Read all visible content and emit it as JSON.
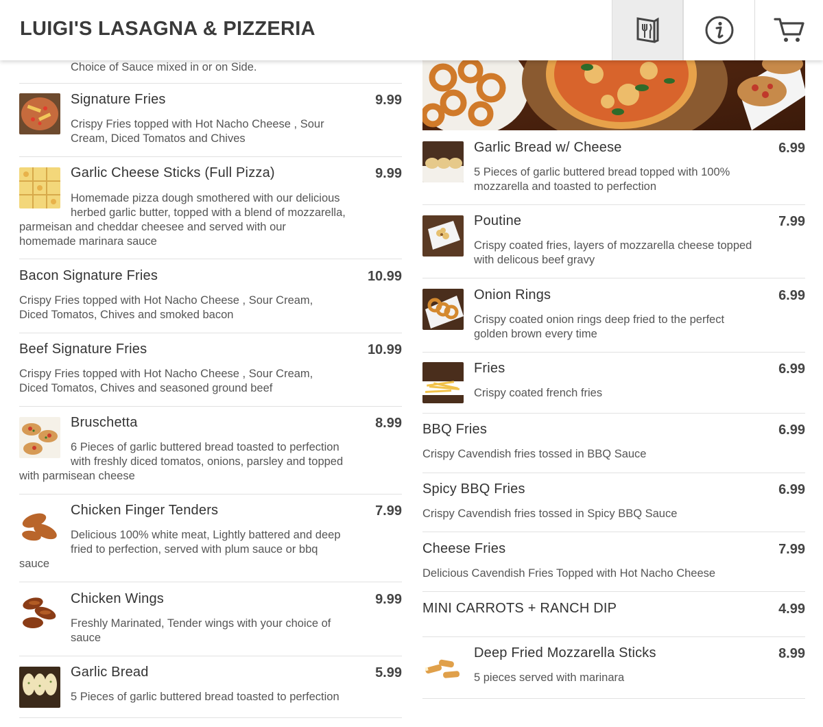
{
  "header": {
    "title": "LUIGI'S LASAGNA & PIZZERIA",
    "icons": {
      "menu": "menu-utensils-icon",
      "info": "info-icon",
      "cart": "cart-icon"
    }
  },
  "colors": {
    "accent_bg": "#ececec",
    "text": "#333333",
    "price": "#444444"
  },
  "left": {
    "partial_desc": "Choice of Sauce mixed in or on Side.",
    "items": [
      {
        "name": "Signature Fries",
        "price": "9.99",
        "desc1": "Crispy Fries topped with Hot Nacho Cheese , Sour",
        "desc2": "Cream, Diced Tomatos and Chives",
        "icon": "signature-fries-photo"
      },
      {
        "name": "Garlic Cheese Sticks (Full Pizza)",
        "price": "9.99",
        "desc1": "Homemade pizza dough smothered with our delicious",
        "desc2": "herbed garlic butter, topped with a blend of mozzarella,",
        "desc3": "parmeisan and cheddar cheesee and served with our",
        "desc4": "homemade marinara sauce",
        "icon": "garlic-cheese-sticks-photo"
      },
      {
        "name": "Bacon Signature Fries",
        "price": "10.99",
        "desc1": "Crispy Fries topped with Hot Nacho Cheese , Sour Cream,",
        "desc2": "Diced Tomatos, Chives and smoked bacon"
      },
      {
        "name": "Beef Signature Fries",
        "price": "10.99",
        "desc1": "Crispy Fries topped with Hot Nacho Cheese , Sour Cream,",
        "desc2": "Diced Tomatos, Chives and seasoned ground beef"
      },
      {
        "name": "Bruschetta",
        "price": "8.99",
        "desc1": "6 Pieces of garlic buttered bread toasted to perfection",
        "desc2": "with freshly diced tomatos, onions, parsley and topped",
        "desc3": "with parmisean cheese",
        "icon": "bruschetta-photo"
      },
      {
        "name": "Chicken Finger Tenders",
        "price": "7.99",
        "desc1": "Delicious 100% white meat, Lightly battered and deep",
        "desc2": "fried to perfection, served with plum sauce or bbq",
        "desc3": "sauce",
        "icon": "chicken-tenders-photo"
      },
      {
        "name": "Chicken Wings",
        "price": "9.99",
        "desc1": "Freshly Marinated, Tender wings with your choice of",
        "desc2": "sauce",
        "icon": "chicken-wings-photo"
      },
      {
        "name": "Garlic Bread",
        "price": "5.99",
        "desc1": "5 Pieces of garlic buttered bread toasted to perfection",
        "icon": "garlic-bread-photo"
      }
    ]
  },
  "right": {
    "items": [
      {
        "name": "Garlic Bread w/ Cheese",
        "price": "6.99",
        "desc1": "5 Pieces of garlic buttered bread topped with 100%",
        "desc2": "mozzarella and toasted to perfection",
        "icon": "garlic-bread-cheese-photo"
      },
      {
        "name": "Poutine",
        "price": "7.99",
        "desc1": "Crispy coated fries, layers of mozzarella cheese topped",
        "desc2": "with delicous beef gravy",
        "icon": "poutine-photo"
      },
      {
        "name": "Onion Rings",
        "price": "6.99",
        "desc1": "Crispy coated onion rings deep fried to the perfect",
        "desc2": "golden brown every time",
        "icon": "onion-rings-photo"
      },
      {
        "name": "Fries",
        "price": "6.99",
        "desc1": "Crispy coated french fries",
        "icon": "fries-photo"
      },
      {
        "name": "BBQ Fries",
        "price": "6.99",
        "desc1": "Crispy Cavendish fries tossed in BBQ Sauce"
      },
      {
        "name": "Spicy BBQ Fries",
        "price": "6.99",
        "desc1": "Crispy Cavendish fries tossed in Spicy BBQ Sauce"
      },
      {
        "name": "Cheese Fries",
        "price": "7.99",
        "desc1": "Delicious Cavendish Fries Topped with Hot Nacho Cheese"
      },
      {
        "name": "MINI CARROTS + RANCH DIP",
        "price": "4.99"
      },
      {
        "name": "Deep Fried Mozzarella Sticks",
        "price": "8.99",
        "desc1": "5 pieces served with marinara",
        "icon": "mozzarella-sticks-photo"
      }
    ]
  }
}
